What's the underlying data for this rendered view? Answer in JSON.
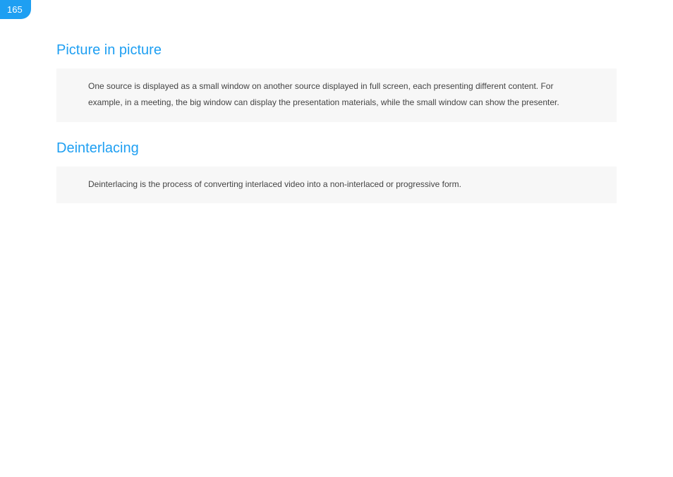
{
  "page_number": "165",
  "sections": [
    {
      "heading": "Picture in picture",
      "description": "One source is displayed as a small window on another source displayed in full screen, each presenting different content. For example, in a meeting, the big window can display the presentation materials, while the small window can show the presenter."
    },
    {
      "heading": "Deinterlacing",
      "description": "Deinterlacing is the process of converting interlaced video into a non-interlaced or progressive form."
    }
  ]
}
